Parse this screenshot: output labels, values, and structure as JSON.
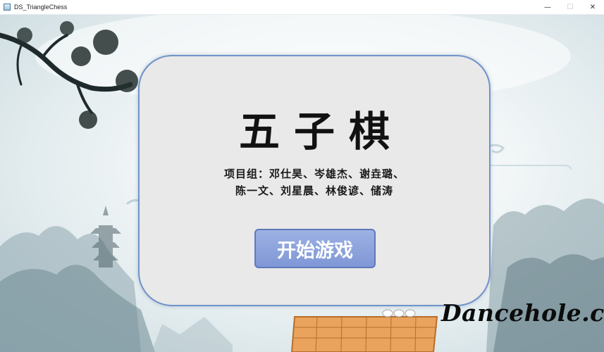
{
  "window": {
    "title": "DS_TriangleChess",
    "minimize_glyph": "—",
    "maximize_glyph": "☐",
    "close_glyph": "✕"
  },
  "panel": {
    "title": "五子棋",
    "credits_line1": "项目组：邓仕昊、岑雄杰、谢垚璐、",
    "credits_line2": "陈一文、刘星晨、林俊谚、储涛",
    "start_button": "开始游戏"
  },
  "watermark": "Dancehole.cn",
  "colors": {
    "panel_bg": "#e9e9e9",
    "panel_border": "#6f94c9",
    "button_top": "#9db1e3",
    "button_bottom": "#7f97d6",
    "board_wood": "#e9a35c"
  }
}
